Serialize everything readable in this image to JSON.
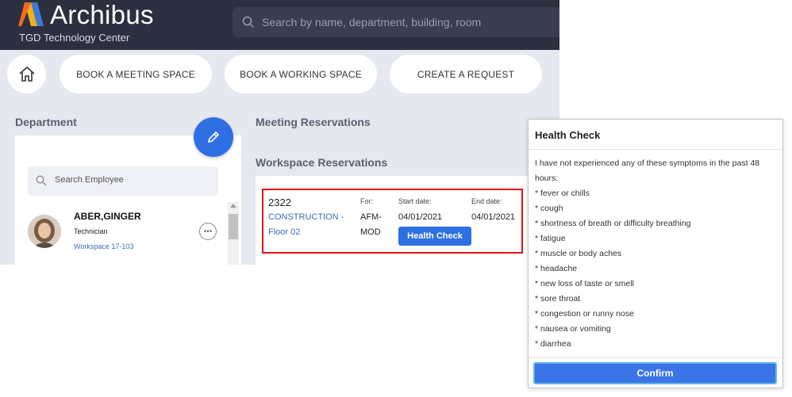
{
  "header": {
    "brand": "Archibus",
    "site": "TGD Technology Center",
    "search_placeholder": "Search by name, department, building, room"
  },
  "nav": {
    "book_meeting": "BOOK A MEETING SPACE",
    "book_working": "BOOK A WORKING SPACE",
    "create_request": "CREATE A REQUEST"
  },
  "department": {
    "title": "Department",
    "search_placeholder": "Search Employee",
    "employee": {
      "name": "ABER,GINGER",
      "role": "Technician",
      "workspace": "Workspace 17-103"
    }
  },
  "meeting": {
    "title": "Meeting Reservations"
  },
  "workspace": {
    "title": "Workspace Reservations",
    "reservation": {
      "id": "2322",
      "location_line1": "CONSTRUCTION -",
      "location_line2": "Floor 02",
      "for_label": "For:",
      "for_line1": "AFM-",
      "for_line2": "MOD",
      "start_label": "Start date:",
      "start_date": "04/01/2021",
      "end_label": "End date:",
      "end_date": "04/01/2021",
      "action": "Health Check"
    }
  },
  "dialog": {
    "title": "Health Check",
    "intro_line1": "I have not experienced any of these symptoms in the past 48",
    "intro_line2": "hours:",
    "symptoms": [
      "* fever or chills",
      "* cough",
      "* shortness of breath or difficulty breathing",
      "* fatigue",
      "* muscle or body aches",
      "* headache",
      "* new loss of taste or smell",
      "* sore throat",
      "* congestion or runny nose",
      "* nausea or vomiting",
      "* diarrhea"
    ],
    "confirm": "Confirm"
  },
  "colors": {
    "topbar": "#2c2f40",
    "accent": "#2f6fe4",
    "highlight": "#e51414"
  }
}
